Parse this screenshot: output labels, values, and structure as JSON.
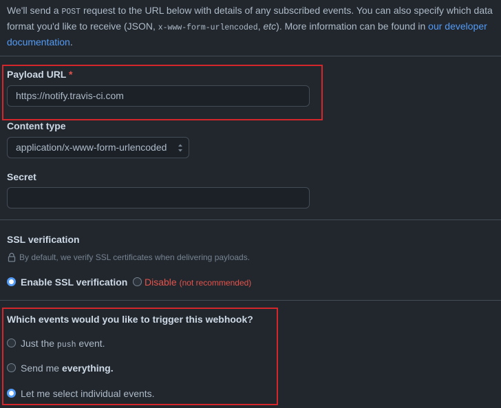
{
  "intro": {
    "part1": "We'll send a ",
    "method": "POST",
    "part2": " request to the URL below with details of any subscribed events. You can also specify which data format you'd like to receive (JSON, ",
    "format_code": "x-www-form-urlencoded",
    "part3": ", ",
    "etc": "etc",
    "part4": "). More information can be found in ",
    "link": "our developer documentation",
    "part5": "."
  },
  "payload": {
    "label": "Payload URL",
    "required_mark": "*",
    "value": "https://notify.travis-ci.com"
  },
  "content_type": {
    "label": "Content type",
    "selected": "application/x-www-form-urlencoded"
  },
  "secret": {
    "label": "Secret",
    "value": ""
  },
  "ssl": {
    "label": "SSL verification",
    "hint": "By default, we verify SSL certificates when delivering payloads.",
    "enable_label": "Enable SSL verification",
    "disable_label": "Disable",
    "disable_note": "(not recommended)",
    "selected": "enable"
  },
  "events": {
    "question": "Which events would you like to trigger this webhook?",
    "opt1_a": "Just the ",
    "opt1_code": "push",
    "opt1_b": " event.",
    "opt2_a": "Send me ",
    "opt2_b": "everything.",
    "opt3": "Let me select individual events.",
    "selected": "individual"
  },
  "colors": {
    "background": "#22272e",
    "accent": "#539bf5",
    "danger": "#e5534b",
    "highlight_box": "#d4262b"
  }
}
